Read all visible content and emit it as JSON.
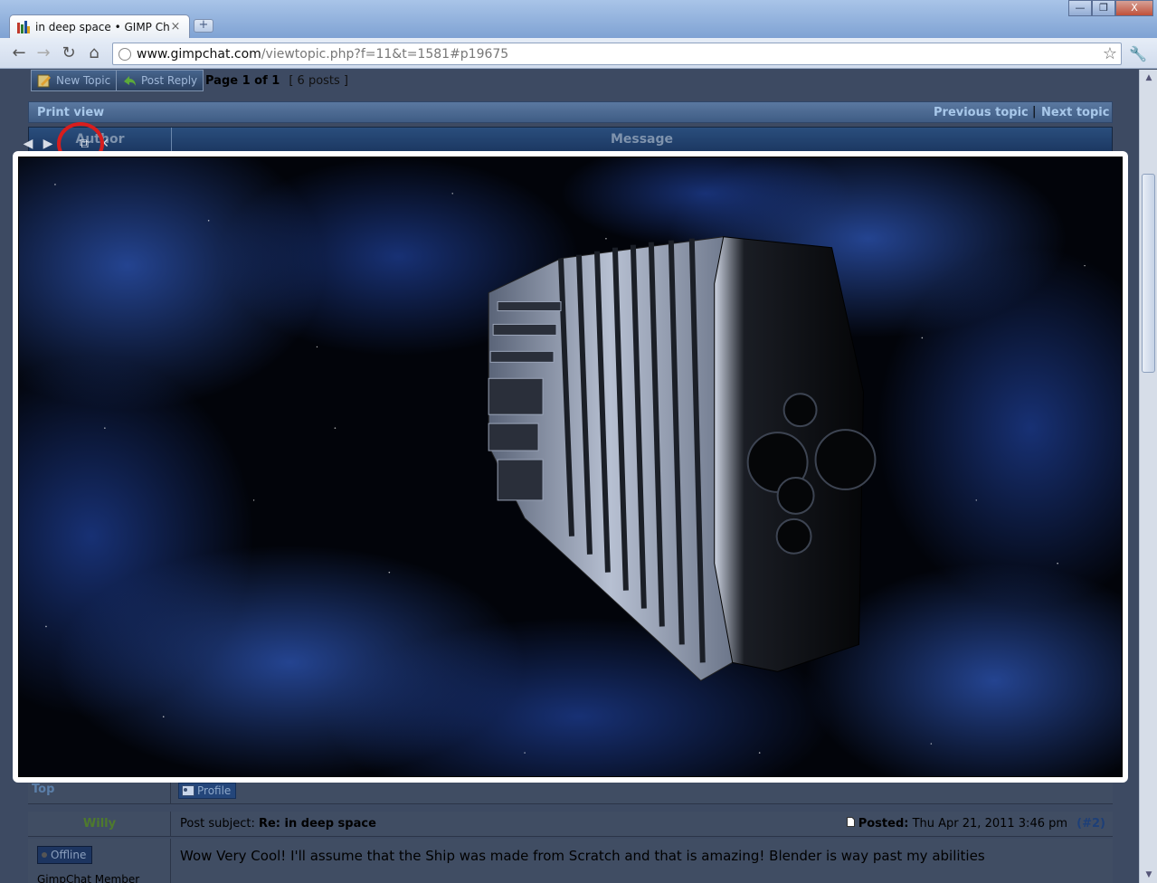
{
  "browser": {
    "tab_title": "in deep space • GIMP Chat",
    "tab_close": "×",
    "new_tab": "+",
    "window_buttons": {
      "minimize": "—",
      "maximize": "❐",
      "close": "X"
    },
    "url_domain": "www.gimpchat.com",
    "url_path": "/viewtopic.php?f=11&t=1581#p19675",
    "nav": {
      "back": "←",
      "forward": "→",
      "reload": "↻",
      "home": "⌂",
      "star": "☆",
      "wrench": "🔧"
    }
  },
  "forum": {
    "new_topic": "New Topic",
    "post_reply": "Post Reply",
    "page_label": "Page 1 of 1",
    "posts_count": "[ 6 posts ]",
    "print_view": "Print view",
    "previous_topic": "Previous topic",
    "separator": "|",
    "next_topic": "Next topic",
    "col_author": "Author",
    "col_message": "Message",
    "top_link": "Top",
    "profile_button": "Profile",
    "post2": {
      "author": "Willy",
      "subject_label": "Post subject:",
      "subject": "Re: in deep space",
      "posted_label": "Posted:",
      "posted_date": "Thu Apr 21, 2011 3:46 pm",
      "post_number": "(#2)",
      "status": "Offline",
      "rank": "GimpChat Member",
      "message": "Wow Very Cool! I'll assume that the Ship was made from Scratch and that is amazing! Blender is way past my abilities"
    }
  },
  "lightbox": {
    "prev": "◀",
    "next": "▶",
    "popout": "⧉",
    "close": "✕"
  },
  "colors": {
    "highlight_ring": "#d81d1d",
    "space_blue": "#1a3c8c",
    "ship_hull": "#8c96aa"
  }
}
